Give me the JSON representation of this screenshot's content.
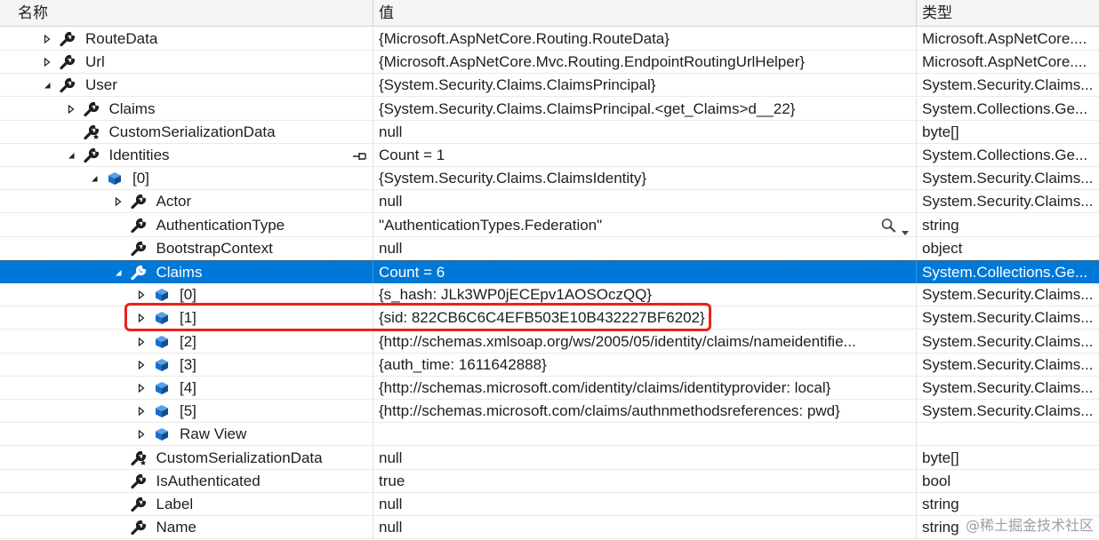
{
  "columns": {
    "name": "名称",
    "value": "值",
    "type": "类型"
  },
  "rows": [
    {
      "label": "RouteData",
      "value": "{Microsoft.AspNetCore.Routing.RouteData}",
      "type": "Microsoft.AspNetCore....",
      "expander": "collapsed",
      "icon": "wrench-icon",
      "indent": 0
    },
    {
      "label": "Url",
      "value": "{Microsoft.AspNetCore.Mvc.Routing.EndpointRoutingUrlHelper}",
      "type": "Microsoft.AspNetCore....",
      "expander": "collapsed",
      "icon": "wrench-icon",
      "indent": 0
    },
    {
      "label": "User",
      "value": "{System.Security.Claims.ClaimsPrincipal}",
      "type": "System.Security.Claims...",
      "expander": "expanded",
      "icon": "wrench-icon",
      "indent": 0
    },
    {
      "label": "Claims",
      "value": "{System.Security.Claims.ClaimsPrincipal.<get_Claims>d__22}",
      "type": "System.Collections.Ge...",
      "expander": "collapsed",
      "icon": "wrench-icon",
      "indent": 1
    },
    {
      "label": "CustomSerializationData",
      "value": "null",
      "type": "byte[]",
      "expander": "none",
      "icon": "wrench-private-icon",
      "indent": 1
    },
    {
      "label": "Identities",
      "value": "Count = 1",
      "type": "System.Collections.Ge...",
      "expander": "expanded",
      "icon": "wrench-icon",
      "indent": 1,
      "pinned": true
    },
    {
      "label": "[0]",
      "value": "{System.Security.Claims.ClaimsIdentity}",
      "type": "System.Security.Claims...",
      "expander": "expanded",
      "icon": "cube-icon",
      "indent": 2
    },
    {
      "label": "Actor",
      "value": "null",
      "type": "System.Security.Claims...",
      "expander": "collapsed",
      "icon": "wrench-icon",
      "indent": 3
    },
    {
      "label": "AuthenticationType",
      "value": "\"AuthenticationTypes.Federation\"",
      "type": "string",
      "expander": "none",
      "icon": "wrench-icon",
      "indent": 3,
      "visualizer": true
    },
    {
      "label": "BootstrapContext",
      "value": "null",
      "type": "object",
      "expander": "none",
      "icon": "wrench-icon",
      "indent": 3
    },
    {
      "label": "Claims",
      "value": "Count = 6",
      "type": "System.Collections.Ge...",
      "expander": "expanded",
      "icon": "wrench-icon",
      "indent": 3,
      "selected": true
    },
    {
      "label": "[0]",
      "value": "{s_hash: JLk3WP0jECEpv1AOSOczQQ}",
      "type": "System.Security.Claims...",
      "expander": "collapsed",
      "icon": "cube-icon",
      "indent": 4
    },
    {
      "label": "[1]",
      "value": "{sid: 822CB6C6C4EFB503E10B432227BF6202}",
      "type": "System.Security.Claims...",
      "expander": "collapsed",
      "icon": "cube-icon",
      "indent": 4
    },
    {
      "label": "[2]",
      "value": "{http://schemas.xmlsoap.org/ws/2005/05/identity/claims/nameidentifie...",
      "type": "System.Security.Claims...",
      "expander": "collapsed",
      "icon": "cube-icon",
      "indent": 4
    },
    {
      "label": "[3]",
      "value": "{auth_time: 1611642888}",
      "type": "System.Security.Claims...",
      "expander": "collapsed",
      "icon": "cube-icon",
      "indent": 4
    },
    {
      "label": "[4]",
      "value": "{http://schemas.microsoft.com/identity/claims/identityprovider: local}",
      "type": "System.Security.Claims...",
      "expander": "collapsed",
      "icon": "cube-icon",
      "indent": 4
    },
    {
      "label": "[5]",
      "value": "{http://schemas.microsoft.com/claims/authnmethodsreferences: pwd}",
      "type": "System.Security.Claims...",
      "expander": "collapsed",
      "icon": "cube-icon",
      "indent": 4
    },
    {
      "label": "Raw View",
      "value": "",
      "type": "",
      "expander": "collapsed",
      "icon": "cube-icon",
      "indent": 4
    },
    {
      "label": "CustomSerializationData",
      "value": "null",
      "type": "byte[]",
      "expander": "none",
      "icon": "wrench-private-icon",
      "indent": 3
    },
    {
      "label": "IsAuthenticated",
      "value": "true",
      "type": "bool",
      "expander": "none",
      "icon": "wrench-icon",
      "indent": 3
    },
    {
      "label": "Label",
      "value": "null",
      "type": "string",
      "expander": "none",
      "icon": "wrench-icon",
      "indent": 3
    },
    {
      "label": "Name",
      "value": "null",
      "type": "string",
      "expander": "none",
      "icon": "wrench-icon",
      "indent": 3
    }
  ],
  "watermark": "@稀土掘金技术社区",
  "colors": {
    "selection": "#0078d7",
    "highlight_border": "#e8231b",
    "icon_blue": "#1a6fc9"
  }
}
